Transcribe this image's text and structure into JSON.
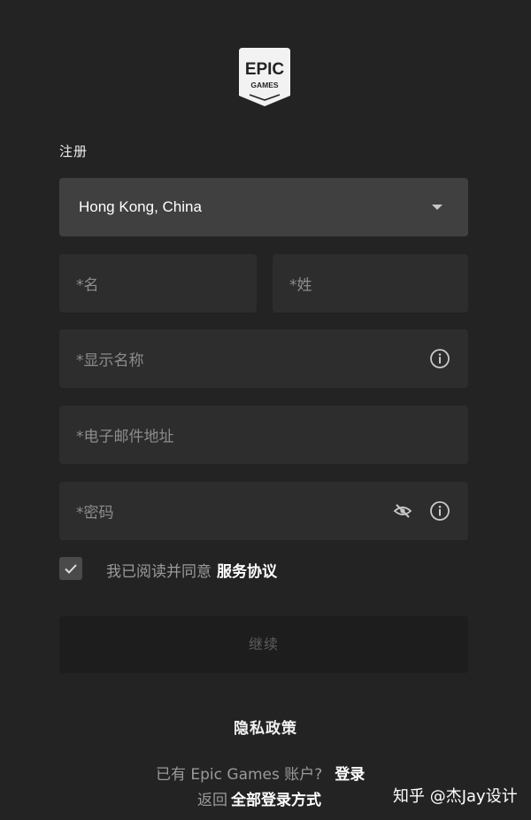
{
  "logo": {
    "line1": "EPIC",
    "line2": "GAMES"
  },
  "form": {
    "title": "注册",
    "country": {
      "value": "Hong Kong, China",
      "icon": "chevron-down-icon"
    },
    "first_name": {
      "placeholder": "*名"
    },
    "last_name": {
      "placeholder": "*姓"
    },
    "display_name": {
      "placeholder": "*显示名称",
      "icon": "info-icon"
    },
    "email": {
      "placeholder": "*电子邮件地址"
    },
    "password": {
      "placeholder": "*密码",
      "icons": [
        "eye-off-icon",
        "info-icon"
      ]
    },
    "agree": {
      "checked": true,
      "text": "我已阅读并同意",
      "link": "服务协议"
    },
    "continue_label": "继续"
  },
  "footer": {
    "privacy": "隐私政策",
    "has_account": "已有 Epic Games 账户?",
    "login": "登录",
    "back": "返回",
    "all_login": "全部登录方式"
  },
  "watermark": "知乎 @杰Jay设计",
  "colors": {
    "background": "#232323",
    "field": "#2d2d2d",
    "select": "#404040",
    "button_disabled": "#1d1d1d"
  }
}
